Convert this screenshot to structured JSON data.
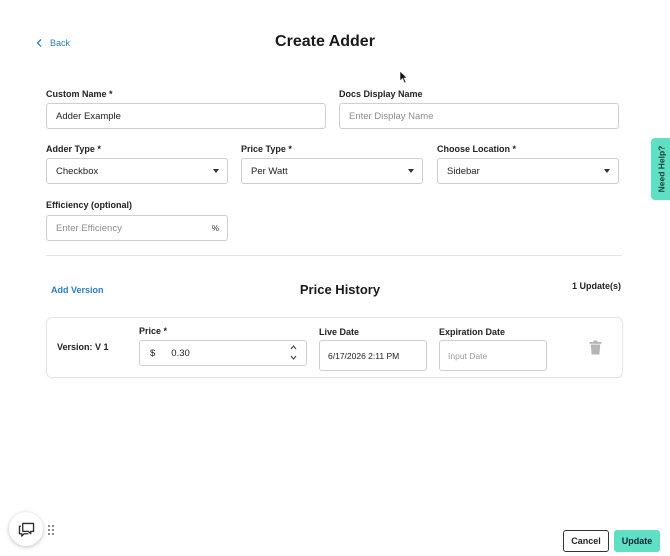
{
  "header": {
    "back_label": "Back",
    "title": "Create Adder"
  },
  "form": {
    "custom_name": {
      "label": "Custom Name *",
      "value": "Adder Example"
    },
    "docs_display_name": {
      "label": "Docs Display Name",
      "placeholder": "Enter Display Name"
    },
    "adder_type": {
      "label": "Adder Type *",
      "value": "Checkbox"
    },
    "price_type": {
      "label": "Price Type *",
      "value": "Per Watt"
    },
    "location": {
      "label": "Choose Location *",
      "value": "Sidebar"
    },
    "efficiency": {
      "label": "Efficiency (optional)",
      "placeholder": "Enter Efficiency",
      "suffix": "%"
    }
  },
  "price_history": {
    "add_version_label": "Add Version",
    "title": "Price History",
    "updates_count": "1 Update(s)",
    "versions": [
      {
        "label": "Version: V 1",
        "price_label": "Price *",
        "currency": "$",
        "price": "0.30",
        "live_date_label": "Live Date",
        "live_date": "6/17/2026 2:11 PM",
        "expiration_label": "Expiration Date",
        "expiration_placeholder": "Input Date"
      }
    ]
  },
  "help_tab": {
    "label": "Need Help?"
  },
  "footer": {
    "cancel_label": "Cancel",
    "update_label": "Update"
  },
  "colors": {
    "accent": "#5fe0c4",
    "link": "#2a7fc1",
    "border": "#cfcfcf"
  },
  "icons": [
    "chevron-left-icon",
    "mouse-cursor-icon",
    "caret-down-icon",
    "stepper-icon",
    "trash-icon",
    "chat-icon",
    "drag-handle-icon"
  ]
}
